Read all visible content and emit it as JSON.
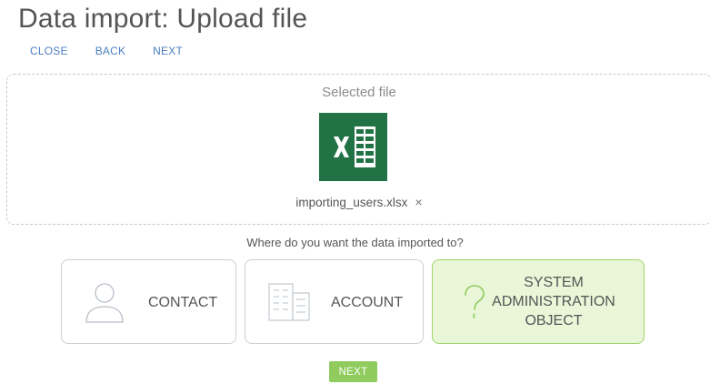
{
  "page": {
    "title": "Data import: Upload file"
  },
  "toolbar": {
    "close_label": "CLOSE",
    "back_label": "BACK",
    "next_label": "NEXT"
  },
  "dropzone": {
    "label": "Selected file",
    "file_icon": "excel-file-icon",
    "file_name": "importing_users.xlsx",
    "remove_glyph": "×"
  },
  "destination": {
    "question": "Where do you want the data imported to?",
    "options": [
      {
        "label": "CONTACT",
        "icon": "contact-person-icon",
        "selected": false
      },
      {
        "label": "ACCOUNT",
        "icon": "account-building-icon",
        "selected": false
      },
      {
        "label": "SYSTEM\nADMINISTRATION\nOBJECT",
        "icon": "question-mark-icon",
        "selected": true
      }
    ]
  },
  "footer": {
    "next_label": "NEXT"
  },
  "colors": {
    "accent_link": "#4b7fc1",
    "excel_green": "#217346",
    "selected_bg": "#e9f6d8",
    "selected_border": "#9ed56a",
    "next_button": "#8fcb5d"
  }
}
